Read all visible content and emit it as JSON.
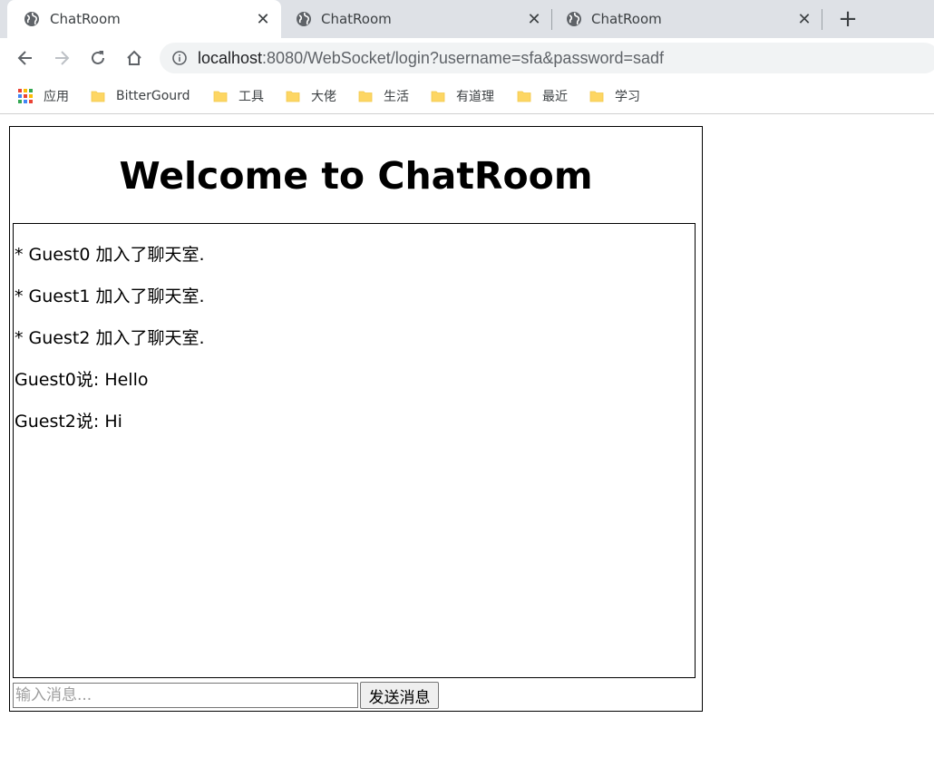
{
  "browser": {
    "tabs": [
      {
        "title": "ChatRoom",
        "active": true
      },
      {
        "title": "ChatRoom",
        "active": false
      },
      {
        "title": "ChatRoom",
        "active": false
      }
    ],
    "address": {
      "host": "localhost",
      "rest": ":8080/WebSocket/login?username=sfa&password=sadf"
    },
    "bookmarks": [
      {
        "label": "应用",
        "icon": "apps-icon"
      },
      {
        "label": "BitterGourd",
        "icon": "folder-icon"
      },
      {
        "label": "工具",
        "icon": "folder-icon"
      },
      {
        "label": "大佬",
        "icon": "folder-icon"
      },
      {
        "label": "生活",
        "icon": "folder-icon"
      },
      {
        "label": "有道理",
        "icon": "folder-icon"
      },
      {
        "label": "最近",
        "icon": "folder-icon"
      },
      {
        "label": "学习",
        "icon": "folder-icon"
      }
    ],
    "colors": {
      "tabstrip": "#dee1e6",
      "omnibox": "#f1f3f4",
      "folder": "#fdd663"
    }
  },
  "chat": {
    "title": "Welcome to ChatRoom",
    "messages": [
      "* Guest0 加入了聊天室.",
      "* Guest1 加入了聊天室.",
      "* Guest2 加入了聊天室.",
      "Guest0说: Hello",
      "Guest2说: Hi"
    ],
    "input": {
      "value": "",
      "placeholder": "输入消息..."
    },
    "send_label": "发送消息"
  }
}
